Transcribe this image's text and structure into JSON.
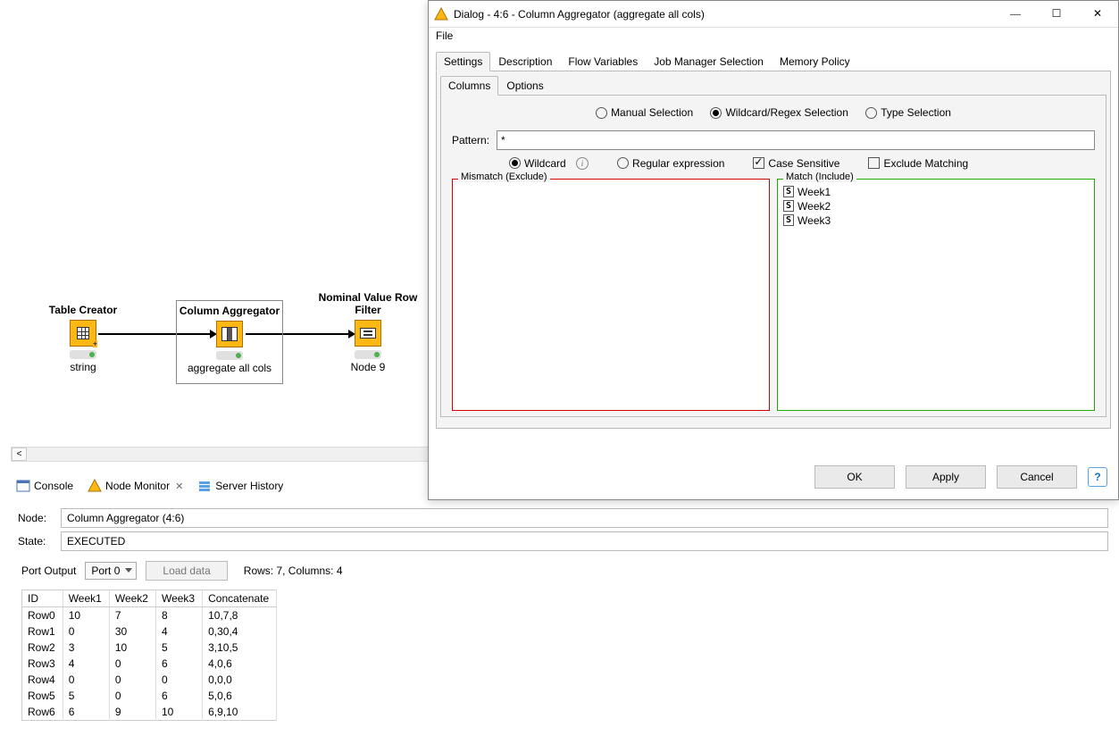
{
  "workflow": {
    "nodes": [
      {
        "title": "Table Creator",
        "label": "string"
      },
      {
        "title": "Column Aggregator",
        "label": "aggregate all cols"
      },
      {
        "title": "Nominal Value Row Filter",
        "label": "Node 9"
      }
    ]
  },
  "views": {
    "console": "Console",
    "node_monitor": "Node Monitor",
    "server_history": "Server History"
  },
  "info": {
    "node_label": "Node:",
    "node_value": "Column Aggregator  (4:6)",
    "state_label": "State:",
    "state_value": "EXECUTED"
  },
  "port": {
    "label": "Port Output",
    "selected": "Port 0",
    "load_btn": "Load data",
    "summary": "Rows: 7, Columns: 4"
  },
  "table": {
    "headers": [
      "ID",
      "Week1",
      "Week2",
      "Week3",
      "Concatenate"
    ],
    "rows": [
      [
        "Row0",
        "10",
        "7",
        "8",
        "10,7,8"
      ],
      [
        "Row1",
        "0",
        "30",
        "4",
        "0,30,4"
      ],
      [
        "Row2",
        "3",
        "10",
        "5",
        "3,10,5"
      ],
      [
        "Row3",
        "4",
        "0",
        "6",
        "4,0,6"
      ],
      [
        "Row4",
        "0",
        "0",
        "0",
        "0,0,0"
      ],
      [
        "Row5",
        "5",
        "0",
        "6",
        "5,0,6"
      ],
      [
        "Row6",
        "6",
        "9",
        "10",
        "6,9,10"
      ]
    ]
  },
  "dialog": {
    "title": "Dialog - 4:6 - Column Aggregator (aggregate all cols)",
    "menu_file": "File",
    "tabs": {
      "settings": "Settings",
      "description": "Description",
      "flow_vars": "Flow Variables",
      "job_mgr": "Job Manager Selection",
      "mem_policy": "Memory Policy"
    },
    "inner_tabs": {
      "columns": "Columns",
      "options": "Options"
    },
    "sel_mode": {
      "manual": "Manual Selection",
      "wildcard": "Wildcard/Regex Selection",
      "type": "Type Selection"
    },
    "pattern_label": "Pattern:",
    "pattern_value": "*",
    "opts": {
      "wildcard": "Wildcard",
      "regex": "Regular expression",
      "case_sensitive": "Case Sensitive",
      "exclude_matching": "Exclude Matching",
      "info_i": "i"
    },
    "mismatch_legend": "Mismatch (Exclude)",
    "match_legend": "Match (Include)",
    "match_items": [
      "Week1",
      "Week2",
      "Week3"
    ],
    "buttons": {
      "ok": "OK",
      "apply": "Apply",
      "cancel": "Cancel",
      "help": "?"
    }
  }
}
